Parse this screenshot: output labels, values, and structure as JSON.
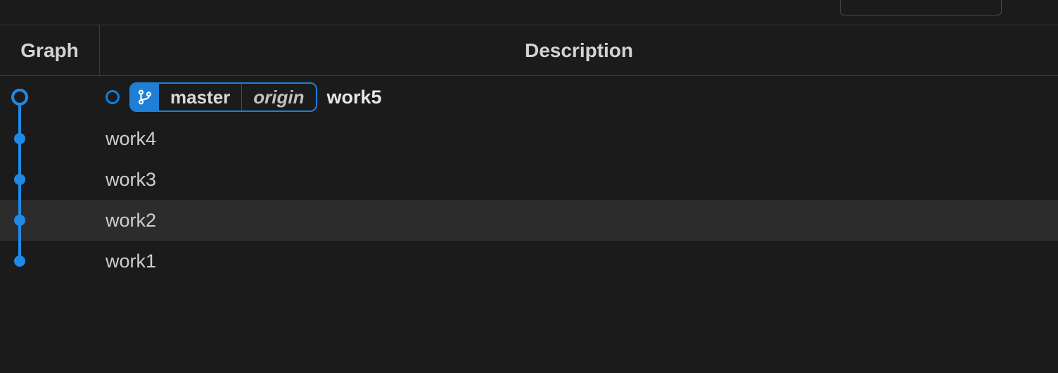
{
  "columns": {
    "graph": "Graph",
    "description": "Description"
  },
  "branch": {
    "local": "master",
    "remote": "origin"
  },
  "colors": {
    "accent": "#1f7fd6",
    "node": "#1f8ae6"
  },
  "commits": [
    {
      "message": "work5",
      "head": true,
      "highlighted": false
    },
    {
      "message": "work4",
      "head": false,
      "highlighted": false
    },
    {
      "message": "work3",
      "head": false,
      "highlighted": false
    },
    {
      "message": "work2",
      "head": false,
      "highlighted": true
    },
    {
      "message": "work1",
      "head": false,
      "highlighted": false
    }
  ]
}
